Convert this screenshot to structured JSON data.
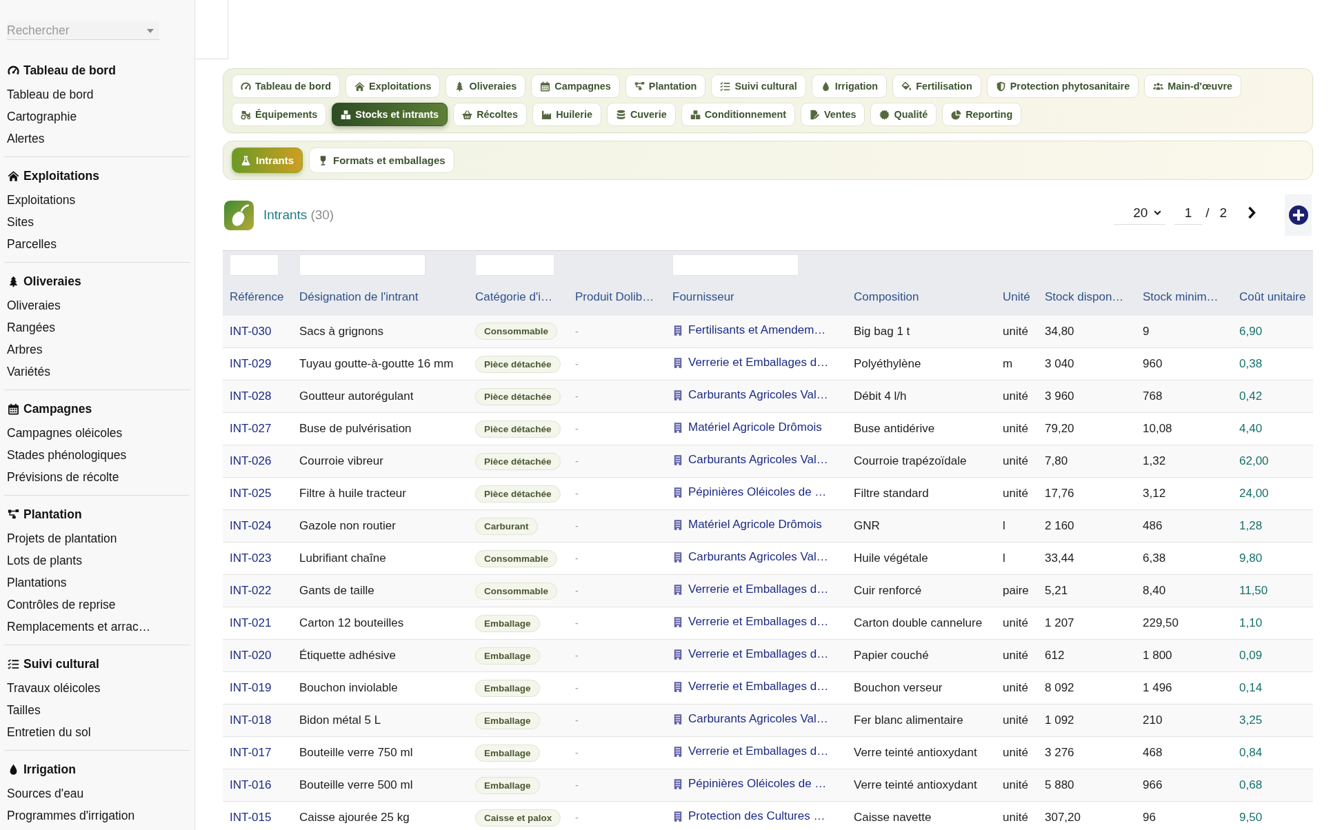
{
  "sidebar": {
    "search": {
      "placeholder": "Rechercher"
    },
    "groups": [
      {
        "title": "Tableau de bord",
        "items": [
          "Tableau de bord",
          "Cartographie",
          "Alertes"
        ]
      },
      {
        "title": "Exploitations",
        "items": [
          "Exploitations",
          "Sites",
          "Parcelles"
        ]
      },
      {
        "title": "Oliveraies",
        "items": [
          "Oliveraies",
          "Rangées",
          "Arbres",
          "Variétés"
        ]
      },
      {
        "title": "Campagnes",
        "items": [
          "Campagnes oléicoles",
          "Stades phénologiques",
          "Prévisions de récolte"
        ]
      },
      {
        "title": "Plantation",
        "items": [
          "Projets de plantation",
          "Lots de plants",
          "Plantations",
          "Contrôles de reprise",
          "Remplacements et arrac…"
        ]
      },
      {
        "title": "Suivi cultural",
        "items": [
          "Travaux oléicoles",
          "Tailles",
          "Entretien du sol"
        ]
      },
      {
        "title": "Irrigation",
        "items": [
          "Sources d'eau",
          "Programmes d'irrigation"
        ]
      }
    ]
  },
  "main_tabs": [
    {
      "label": "Tableau de bord",
      "selected": false
    },
    {
      "label": "Exploitations",
      "selected": false
    },
    {
      "label": "Oliveraies",
      "selected": false
    },
    {
      "label": "Campagnes",
      "selected": false
    },
    {
      "label": "Plantation",
      "selected": false
    },
    {
      "label": "Suivi cultural",
      "selected": false
    },
    {
      "label": "Irrigation",
      "selected": false
    },
    {
      "label": "Fertilisation",
      "selected": false
    },
    {
      "label": "Protection phytosanitaire",
      "selected": false
    },
    {
      "label": "Main-d'œuvre",
      "selected": false
    },
    {
      "label": "Équipements",
      "selected": false
    },
    {
      "label": "Stocks et intrants",
      "selected": true
    },
    {
      "label": "Récoltes",
      "selected": false
    },
    {
      "label": "Huilerie",
      "selected": false
    },
    {
      "label": "Cuverie",
      "selected": false
    },
    {
      "label": "Conditionnement",
      "selected": false
    },
    {
      "label": "Ventes",
      "selected": false
    },
    {
      "label": "Qualité",
      "selected": false
    },
    {
      "label": "Reporting",
      "selected": false
    }
  ],
  "sub_tabs": [
    {
      "label": "Intrants",
      "selected": true
    },
    {
      "label": "Formats et emballages",
      "selected": false
    }
  ],
  "list_header": {
    "title": "Intrants",
    "count": "(30)",
    "page_size": "20",
    "page": "1",
    "page_separator": "/",
    "page_total": "2"
  },
  "table": {
    "columns": [
      {
        "label": "Référence",
        "filter": true
      },
      {
        "label": "Désignation de l'intrant",
        "filter": true
      },
      {
        "label": "Catégorie d'i…",
        "filter": true
      },
      {
        "label": "Produit Dolib…",
        "filter": false
      },
      {
        "label": "Fournisseur",
        "filter": true
      },
      {
        "label": "Composition",
        "filter": false
      },
      {
        "label": "Unité",
        "filter": false
      },
      {
        "label": "Stock dispon…",
        "filter": false
      },
      {
        "label": "Stock minim…",
        "filter": false
      },
      {
        "label": "Coût unitaire",
        "filter": false
      }
    ],
    "rows": [
      {
        "reference": "INT-030",
        "designation": "Sacs à grignons",
        "category": "Consommable",
        "product": "-",
        "supplier": "Fertilisants et Amendem…",
        "composition": "Big bag 1 t",
        "unit": "unité",
        "stock_available": "34,80",
        "stock_minimum": "9",
        "unit_cost": "6,90"
      },
      {
        "reference": "INT-029",
        "designation": "Tuyau goutte-à-goutte 16 mm",
        "category": "Pièce détachée",
        "product": "-",
        "supplier": "Verrerie et Emballages d…",
        "composition": "Polyéthylène",
        "unit": "m",
        "stock_available": "3 040",
        "stock_minimum": "960",
        "unit_cost": "0,38"
      },
      {
        "reference": "INT-028",
        "designation": "Goutteur autorégulant",
        "category": "Pièce détachée",
        "product": "-",
        "supplier": "Carburants Agricoles Val…",
        "composition": "Débit 4 l/h",
        "unit": "unité",
        "stock_available": "3 960",
        "stock_minimum": "768",
        "unit_cost": "0,42"
      },
      {
        "reference": "INT-027",
        "designation": "Buse de pulvérisation",
        "category": "Pièce détachée",
        "product": "-",
        "supplier": "Matériel Agricole Drômois",
        "composition": "Buse antidérive",
        "unit": "unité",
        "stock_available": "79,20",
        "stock_minimum": "10,08",
        "unit_cost": "4,40"
      },
      {
        "reference": "INT-026",
        "designation": "Courroie vibreur",
        "category": "Pièce détachée",
        "product": "-",
        "supplier": "Carburants Agricoles Val…",
        "composition": "Courroie trapézoïdale",
        "unit": "unité",
        "stock_available": "7,80",
        "stock_minimum": "1,32",
        "unit_cost": "62,00"
      },
      {
        "reference": "INT-025",
        "designation": "Filtre à huile tracteur",
        "category": "Pièce détachée",
        "product": "-",
        "supplier": "Pépinières Oléicoles de …",
        "composition": "Filtre standard",
        "unit": "unité",
        "stock_available": "17,76",
        "stock_minimum": "3,12",
        "unit_cost": "24,00"
      },
      {
        "reference": "INT-024",
        "designation": "Gazole non routier",
        "category": "Carburant",
        "product": "-",
        "supplier": "Matériel Agricole Drômois",
        "composition": "GNR",
        "unit": "l",
        "stock_available": "2 160",
        "stock_minimum": "486",
        "unit_cost": "1,28"
      },
      {
        "reference": "INT-023",
        "designation": "Lubrifiant chaîne",
        "category": "Consommable",
        "product": "-",
        "supplier": "Carburants Agricoles Val…",
        "composition": "Huile végétale",
        "unit": "l",
        "stock_available": "33,44",
        "stock_minimum": "6,38",
        "unit_cost": "9,80"
      },
      {
        "reference": "INT-022",
        "designation": "Gants de taille",
        "category": "Consommable",
        "product": "-",
        "supplier": "Verrerie et Emballages d…",
        "composition": "Cuir renforcé",
        "unit": "paire",
        "stock_available": "5,21",
        "stock_minimum": "8,40",
        "unit_cost": "11,50"
      },
      {
        "reference": "INT-021",
        "designation": "Carton 12 bouteilles",
        "category": "Emballage",
        "product": "-",
        "supplier": "Verrerie et Emballages d…",
        "composition": "Carton double cannelure",
        "unit": "unité",
        "stock_available": "1 207",
        "stock_minimum": "229,50",
        "unit_cost": "1,10"
      },
      {
        "reference": "INT-020",
        "designation": "Étiquette adhésive",
        "category": "Emballage",
        "product": "-",
        "supplier": "Verrerie et Emballages d…",
        "composition": "Papier couché",
        "unit": "unité",
        "stock_available": "612",
        "stock_minimum": "1 800",
        "unit_cost": "0,09"
      },
      {
        "reference": "INT-019",
        "designation": "Bouchon inviolable",
        "category": "Emballage",
        "product": "-",
        "supplier": "Verrerie et Emballages d…",
        "composition": "Bouchon verseur",
        "unit": "unité",
        "stock_available": "8 092",
        "stock_minimum": "1 496",
        "unit_cost": "0,14"
      },
      {
        "reference": "INT-018",
        "designation": "Bidon métal 5 L",
        "category": "Emballage",
        "product": "-",
        "supplier": "Carburants Agricoles Val…",
        "composition": "Fer blanc alimentaire",
        "unit": "unité",
        "stock_available": "1 092",
        "stock_minimum": "210",
        "unit_cost": "3,25"
      },
      {
        "reference": "INT-017",
        "designation": "Bouteille verre 750 ml",
        "category": "Emballage",
        "product": "-",
        "supplier": "Verrerie et Emballages d…",
        "composition": "Verre teinté antioxydant",
        "unit": "unité",
        "stock_available": "3 276",
        "stock_minimum": "468",
        "unit_cost": "0,84"
      },
      {
        "reference": "INT-016",
        "designation": "Bouteille verre 500 ml",
        "category": "Emballage",
        "product": "-",
        "supplier": "Pépinières Oléicoles de …",
        "composition": "Verre teinté antioxydant",
        "unit": "unité",
        "stock_available": "5 880",
        "stock_minimum": "966",
        "unit_cost": "0,68"
      },
      {
        "reference": "INT-015",
        "designation": "Caisse ajourée 25 kg",
        "category": "Caisse et palox",
        "product": "-",
        "supplier": "Protection des Cultures …",
        "composition": "Caisse navette",
        "unit": "unité",
        "stock_available": "307,20",
        "stock_minimum": "96",
        "unit_cost": "9,50"
      }
    ]
  }
}
